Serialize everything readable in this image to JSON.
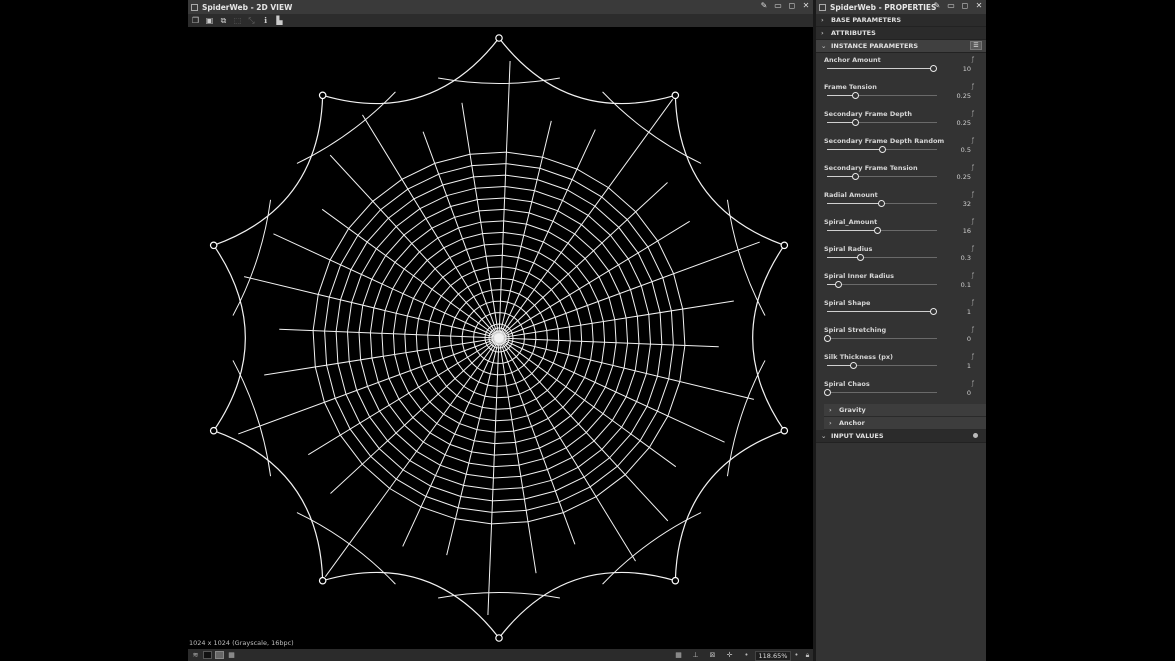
{
  "view2d": {
    "title": "SpiderWeb - 2D VIEW",
    "status_resolution": "1024 x 1024 (Grayscale, 16bpc)",
    "zoom": "118.65%"
  },
  "properties": {
    "title": "SpiderWeb - PROPERTIES",
    "sections": {
      "base": "BASE PARAMETERS",
      "attributes": "ATTRIBUTES",
      "instance": "INSTANCE PARAMETERS",
      "input_values": "INPUT VALUES"
    },
    "params": [
      {
        "label": "Anchor Amount",
        "value": "10",
        "fraction": 0.96
      },
      {
        "label": "Frame Tension",
        "value": "0.25",
        "fraction": 0.25
      },
      {
        "label": "Secondary Frame Depth",
        "value": "0.25",
        "fraction": 0.25
      },
      {
        "label": "Secondary Frame Depth Random",
        "value": "0.5",
        "fraction": 0.5
      },
      {
        "label": "Secondary Frame Tension",
        "value": "0.25",
        "fraction": 0.25
      },
      {
        "label": "Radial Amount",
        "value": "32",
        "fraction": 0.49
      },
      {
        "label": "Spiral_Amount",
        "value": "16",
        "fraction": 0.45
      },
      {
        "label": "Spiral Radius",
        "value": "0.3",
        "fraction": 0.3
      },
      {
        "label": "Spiral Inner Radius",
        "value": "0.1",
        "fraction": 0.1
      },
      {
        "label": "Spiral Shape",
        "value": "1",
        "fraction": 0.96
      },
      {
        "label": "Spiral Stretching",
        "value": "0",
        "fraction": 0.0
      },
      {
        "label": "Silk Thickness (px)",
        "value": "1",
        "fraction": 0.24
      },
      {
        "label": "Spiral Chaos",
        "value": "0",
        "fraction": 0.0
      }
    ],
    "subsections": [
      "Gravity",
      "Anchor"
    ]
  }
}
